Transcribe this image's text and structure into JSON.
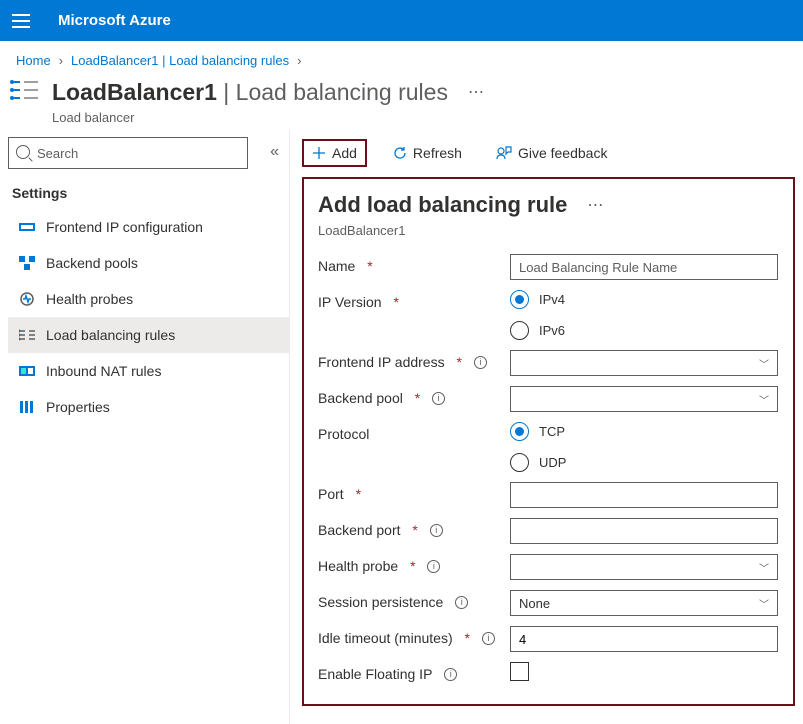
{
  "topbar": {
    "brand": "Microsoft Azure"
  },
  "breadcrumbs": {
    "home": "Home",
    "second": "LoadBalancer1 | Load balancing rules"
  },
  "page": {
    "title_main": "LoadBalancer1",
    "title_sep": " | ",
    "title_light": "Load balancing rules",
    "subtitle": "Load balancer"
  },
  "sidebar": {
    "search_placeholder": "Search",
    "section": "Settings",
    "items": [
      {
        "label": "Frontend IP configuration"
      },
      {
        "label": "Backend pools"
      },
      {
        "label": "Health probes"
      },
      {
        "label": "Load balancing rules"
      },
      {
        "label": "Inbound NAT rules"
      },
      {
        "label": "Properties"
      }
    ]
  },
  "cmdbar": {
    "add": "Add",
    "refresh": "Refresh",
    "feedback": "Give feedback"
  },
  "panel": {
    "title": "Add load balancing rule",
    "subtitle": "LoadBalancer1",
    "fields": {
      "name": {
        "label": "Name",
        "placeholder": "Load Balancing Rule Name"
      },
      "ipver": {
        "label": "IP Version",
        "v4": "IPv4",
        "v6": "IPv6"
      },
      "frontend": {
        "label": "Frontend IP address"
      },
      "backend": {
        "label": "Backend pool"
      },
      "protocol": {
        "label": "Protocol",
        "tcp": "TCP",
        "udp": "UDP"
      },
      "port": {
        "label": "Port"
      },
      "bport": {
        "label": "Backend port"
      },
      "probe": {
        "label": "Health probe"
      },
      "session": {
        "label": "Session persistence",
        "value": "None"
      },
      "idle": {
        "label": "Idle timeout (minutes)",
        "value": "4"
      },
      "float": {
        "label": "Enable Floating IP"
      }
    }
  }
}
